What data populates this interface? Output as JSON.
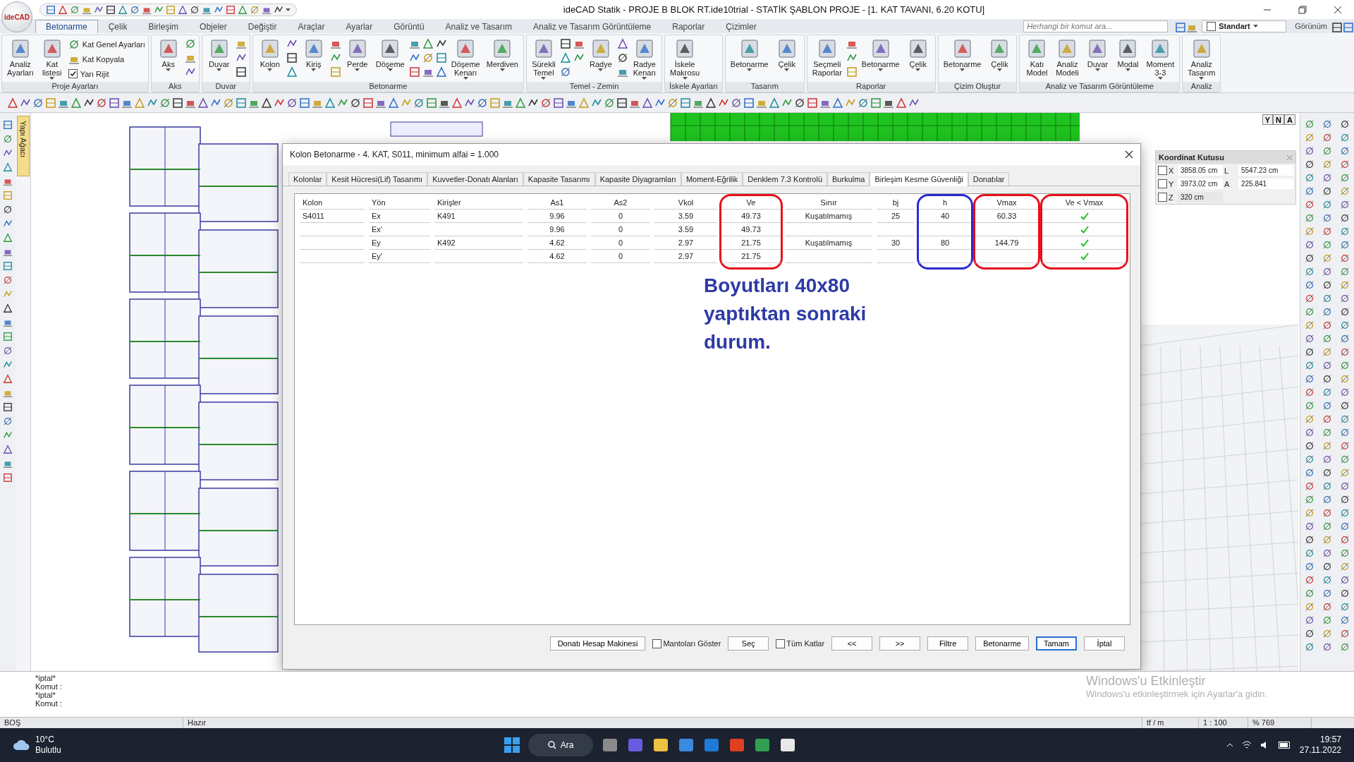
{
  "logo": "ideCAD",
  "window": {
    "title": "ideCAD Statik - PROJE B BLOK RT.ide10trial - STATİK ŞABLON PROJE - [1. KAT TAVANI,  6.20 KOTU]"
  },
  "menu_tabs": [
    {
      "label": "Betonarme",
      "selected": true
    },
    {
      "label": "Çelik",
      "selected": false
    },
    {
      "label": "Birleşim",
      "selected": false
    },
    {
      "label": "Objeler",
      "selected": false
    },
    {
      "label": "Değiştir",
      "selected": false
    },
    {
      "label": "Araçlar",
      "selected": false
    },
    {
      "label": "Ayarlar",
      "selected": false
    },
    {
      "label": "Görüntü",
      "selected": false
    },
    {
      "label": "Analiz ve Tasarım",
      "selected": false
    },
    {
      "label": "Analiz ve Tasarım Görüntüleme",
      "selected": false
    },
    {
      "label": "Raporlar",
      "selected": false
    },
    {
      "label": "Çizimler",
      "selected": false
    }
  ],
  "search": {
    "placeholder": "Herhangi bir komut ara..."
  },
  "view_style": {
    "value": "Standart",
    "locked": false
  },
  "view_menu": "Görünüm",
  "ribbon_groups": [
    {
      "label": "Proje Ayarları",
      "items": [
        {
          "kind": "large",
          "label": "Analiz\nAyarları"
        },
        {
          "kind": "large",
          "label": "Kat\nlistesi",
          "menu": true
        },
        {
          "kind": "small",
          "label": "Kat Genel Ayarları"
        },
        {
          "kind": "small",
          "label": "Kat Kopyala"
        },
        {
          "kind": "check",
          "label": "Yarı Rijit",
          "checked": true
        }
      ]
    },
    {
      "label": "Aks",
      "items": [
        {
          "kind": "large",
          "label": "Aks",
          "menu": true
        },
        {
          "kind": "icon"
        },
        {
          "kind": "icon"
        },
        {
          "kind": "icon"
        }
      ]
    },
    {
      "label": "Duvar",
      "items": [
        {
          "kind": "large",
          "label": "Duvar",
          "menu": true
        },
        {
          "kind": "icon"
        },
        {
          "kind": "icon"
        },
        {
          "kind": "icon"
        }
      ]
    },
    {
      "label": "Betonarme",
      "items": [
        {
          "kind": "large",
          "label": "Kolon",
          "menu": true
        },
        {
          "kind": "icon"
        },
        {
          "kind": "icon"
        },
        {
          "kind": "icon"
        },
        {
          "kind": "large",
          "label": "Kiriş",
          "menu": true
        },
        {
          "kind": "icon"
        },
        {
          "kind": "icon"
        },
        {
          "kind": "icon"
        },
        {
          "kind": "large",
          "label": "Perde",
          "menu": true
        },
        {
          "kind": "large",
          "label": "Döşeme",
          "menu": true
        },
        {
          "kind": "icon"
        },
        {
          "kind": "icon"
        },
        {
          "kind": "icon"
        },
        {
          "kind": "icon"
        },
        {
          "kind": "icon"
        },
        {
          "kind": "icon"
        },
        {
          "kind": "icon"
        },
        {
          "kind": "icon"
        },
        {
          "kind": "icon"
        },
        {
          "kind": "large",
          "label": "Döşeme\nKenarı",
          "menu": true
        },
        {
          "kind": "large",
          "label": "Merdiven",
          "menu": true
        }
      ]
    },
    {
      "label": "Temel - Zemin",
      "items": [
        {
          "kind": "large",
          "label": "Sürekli\nTemel",
          "menu": true
        },
        {
          "kind": "icon"
        },
        {
          "kind": "icon"
        },
        {
          "kind": "icon"
        },
        {
          "kind": "icon"
        },
        {
          "kind": "icon"
        },
        {
          "kind": "large",
          "label": "Radye",
          "menu": true
        },
        {
          "kind": "icon"
        },
        {
          "kind": "icon"
        },
        {
          "kind": "icon"
        },
        {
          "kind": "large",
          "label": "Radye\nKenarı",
          "menu": true
        }
      ]
    },
    {
      "label": "İskele Ayarları",
      "items": [
        {
          "kind": "large",
          "label": "İskele\nMakrosu",
          "menu": true
        }
      ]
    },
    {
      "label": "Tasarım",
      "items": [
        {
          "kind": "large",
          "label": "Betonarme",
          "menu": true
        },
        {
          "kind": "large",
          "label": "Çelik",
          "menu": true
        }
      ]
    },
    {
      "label": "Raporlar",
      "items": [
        {
          "kind": "large",
          "label": "Seçmeli\nRaporlar"
        },
        {
          "kind": "icon"
        },
        {
          "kind": "icon"
        },
        {
          "kind": "icon"
        },
        {
          "kind": "large",
          "label": "Betonarme",
          "menu": true
        },
        {
          "kind": "large",
          "label": "Çelik",
          "menu": true
        }
      ]
    },
    {
      "label": "Çizim Oluştur",
      "items": [
        {
          "kind": "large",
          "label": "Betonarme",
          "menu": true
        },
        {
          "kind": "large",
          "label": "Çelik",
          "menu": true
        }
      ]
    },
    {
      "label": "Analiz ve Tasarım Görüntüleme",
      "items": [
        {
          "kind": "large",
          "label": "Katı\nModel"
        },
        {
          "kind": "large",
          "label": "Analiz\nModeli"
        },
        {
          "kind": "large",
          "label": "Duvar",
          "menu": true
        },
        {
          "kind": "large",
          "label": "Modal",
          "menu": true
        },
        {
          "kind": "large",
          "label": "Moment\n3-3",
          "menu": true
        }
      ]
    },
    {
      "label": "Analiz",
      "items": [
        {
          "kind": "large",
          "label": "Analiz\nTasarım",
          "menu": true
        }
      ]
    }
  ],
  "side_panel_tab": "Yapı Ağacı",
  "view_buttons": [
    "Y",
    "N",
    "A"
  ],
  "dialog": {
    "title": "Kolon Betonarme - 4. KAT, S011, minimum alfai = 1.000",
    "tabs": [
      {
        "label": "Kolonlar",
        "selected": false
      },
      {
        "label": "Kesit Hücresi(Lif) Tasarımı",
        "selected": false
      },
      {
        "label": "Kuvvetler-Donatı Alanları",
        "selected": false
      },
      {
        "label": "Kapasite Tasarımı",
        "selected": false
      },
      {
        "label": "Kapasite Diyagramları",
        "selected": false
      },
      {
        "label": "Moment-Eğrilik",
        "selected": false
      },
      {
        "label": "Denklem 7.3 Kontrolü",
        "selected": false
      },
      {
        "label": "Burkulma",
        "selected": false
      },
      {
        "label": "Birleşim Kesme Güvenliği",
        "selected": true
      },
      {
        "label": "Donatılar",
        "selected": false
      }
    ],
    "table": {
      "columns": [
        {
          "label": "Kolon"
        },
        {
          "label": "Yön"
        },
        {
          "label": "Kirişler"
        },
        {
          "label": "As1"
        },
        {
          "label": "As2"
        },
        {
          "label": "Vkol"
        },
        {
          "label": "Ve",
          "color": "#e8101c"
        },
        {
          "label": "Sınır"
        },
        {
          "label": "bj"
        },
        {
          "label": "h",
          "color": "#2a2ad0"
        },
        {
          "label": "Vmax",
          "color": "#e8101c"
        },
        {
          "label": "Ve < Vmax",
          "color": "#e8101c"
        }
      ],
      "rows": [
        {
          "cells": [
            "S4011",
            "Ex",
            "K491",
            "9.96",
            "0",
            "3.59",
            "49.73",
            "Kuşatılmamış",
            "25",
            "40",
            "60.33"
          ],
          "ok": true
        },
        {
          "cells": [
            null,
            "Ex'",
            null,
            "9.96",
            "0",
            "3.59",
            "49.73",
            null,
            null,
            null,
            null
          ],
          "ok": true
        },
        {
          "cells": [
            null,
            "Ey",
            "K492",
            "4.62",
            "0",
            "2.97",
            "21.75",
            "Kuşatılmamış",
            "30",
            "80",
            "144.79"
          ],
          "ok": true
        },
        {
          "cells": [
            null,
            "Ey'",
            null,
            "4.62",
            "0",
            "2.97",
            "21.75",
            null,
            null,
            null,
            null
          ],
          "ok": true
        }
      ]
    },
    "note": "Boyutları 40x80\nyaptıktan sonraki\ndurum.",
    "buttons": [
      {
        "kind": "button",
        "label": "Donatı Hesap Makinesi"
      },
      {
        "kind": "check",
        "label": "Mantoları Göster",
        "checked": false
      },
      {
        "kind": "button",
        "label": "Seç"
      },
      {
        "kind": "check",
        "label": "Tüm Katlar",
        "checked": false
      },
      {
        "kind": "button",
        "label": "<<"
      },
      {
        "kind": "button",
        "label": ">>"
      },
      {
        "kind": "button",
        "label": "Filtre"
      },
      {
        "kind": "button",
        "label": "Betonarme"
      },
      {
        "kind": "button",
        "label": "Tamam",
        "default": true
      },
      {
        "kind": "button",
        "label": "İptal"
      }
    ]
  },
  "coordinate_box": {
    "title": "Koordinat Kutusu",
    "rows": [
      {
        "axis": "X",
        "checked": false,
        "value": "3858.05 cm",
        "label2": "L",
        "value2": "5547.23 cm"
      },
      {
        "axis": "Y",
        "checked": false,
        "value": "3973.02 cm",
        "label2": "A",
        "value2": "225.841"
      },
      {
        "axis": "Z",
        "checked": false,
        "value": "320 cm"
      }
    ]
  },
  "command_lines": [
    "*iptal*",
    "Komut :",
    "*iptal*",
    "Komut :"
  ],
  "status_bar": [
    "BOŞ",
    "Hazır",
    "tf / m",
    "1 : 100",
    "% 769"
  ],
  "activation": {
    "title": "Windows'u Etkinleştir",
    "text": "Windows'u etkinleştirmek için Ayarlar'a gidin."
  },
  "taskbar": {
    "temperature": "10°C",
    "weather": "Bulutlu",
    "search": "Ara",
    "time": "19:57",
    "date": "27.11.2022"
  }
}
